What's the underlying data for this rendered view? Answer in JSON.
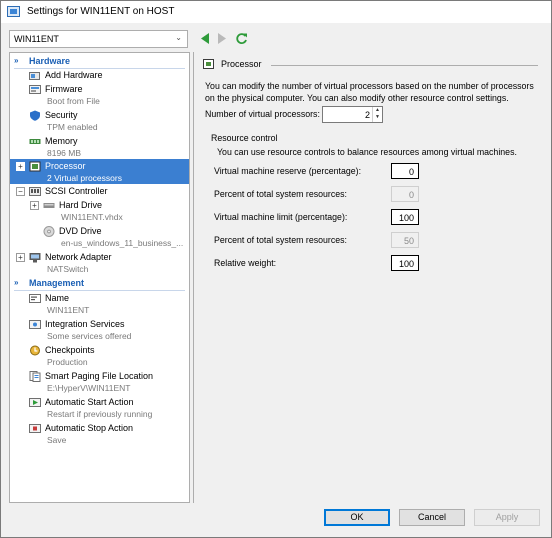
{
  "window": {
    "title": "Settings for WIN11ENT on HOST"
  },
  "vm_selector": {
    "value": "WIN11ENT"
  },
  "tree": {
    "hardware_label": "Hardware",
    "management_label": "Management",
    "hardware": [
      {
        "name": "Add Hardware",
        "sub": ""
      },
      {
        "name": "Firmware",
        "sub": "Boot from File"
      },
      {
        "name": "Security",
        "sub": "TPM enabled"
      },
      {
        "name": "Memory",
        "sub": "8196 MB"
      },
      {
        "name": "Processor",
        "sub": "2 Virtual processors"
      },
      {
        "name": "SCSI Controller",
        "sub": ""
      },
      {
        "name": "Hard Drive",
        "sub": "WIN11ENT.vhdx"
      },
      {
        "name": "DVD Drive",
        "sub": "en-us_windows_11_business_..."
      },
      {
        "name": "Network Adapter",
        "sub": "NATSwitch"
      }
    ],
    "management": [
      {
        "name": "Name",
        "sub": "WIN11ENT"
      },
      {
        "name": "Integration Services",
        "sub": "Some services offered"
      },
      {
        "name": "Checkpoints",
        "sub": "Production"
      },
      {
        "name": "Smart Paging File Location",
        "sub": "E:\\HyperV\\WIN11ENT"
      },
      {
        "name": "Automatic Start Action",
        "sub": "Restart if previously running"
      },
      {
        "name": "Automatic Stop Action",
        "sub": "Save"
      }
    ]
  },
  "panel": {
    "title": "Processor",
    "description": "You can modify the number of virtual processors based on the number of processors on the physical computer. You can also modify other resource control settings.",
    "num_processors_label": "Number of virtual processors:",
    "num_processors_value": "2",
    "resource_control_title": "Resource control",
    "resource_control_desc": "You can use resource controls to balance resources among virtual machines.",
    "fields": [
      {
        "label": "Virtual machine reserve (percentage):",
        "value": "0",
        "disabled": false
      },
      {
        "label": "Percent of total system resources:",
        "value": "0",
        "disabled": true
      },
      {
        "label": "Virtual machine limit (percentage):",
        "value": "100",
        "disabled": false
      },
      {
        "label": "Percent of total system resources:",
        "value": "50",
        "disabled": true
      },
      {
        "label": "Relative weight:",
        "value": "100",
        "disabled": false
      }
    ]
  },
  "buttons": {
    "ok": "OK",
    "cancel": "Cancel",
    "apply": "Apply"
  }
}
